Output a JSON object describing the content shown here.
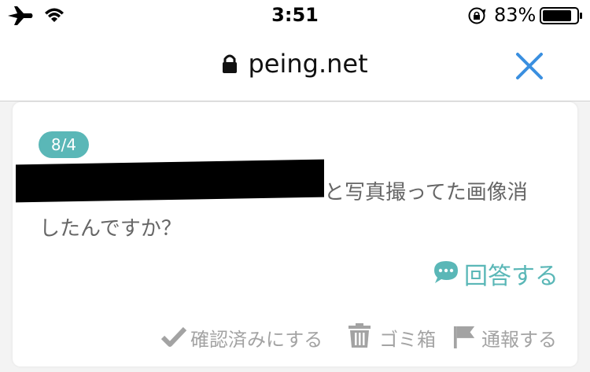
{
  "status_bar": {
    "time": "3:51",
    "battery_percent": "83%",
    "icons": [
      "airplane-icon",
      "wifi-icon",
      "orientation-lock-icon",
      "battery-icon"
    ]
  },
  "address_bar": {
    "url": "peing.net",
    "icons": [
      "lock-icon",
      "close-icon"
    ]
  },
  "card": {
    "date_badge": "8/4",
    "question_line1": "と写真撮ってた画像消",
    "question_line2": "したんですか？",
    "answer_label": "回答する",
    "actions": {
      "confirm": "確認済みにする",
      "trash": "ゴミ箱",
      "report": "通報する"
    }
  },
  "colors": {
    "accent": "#5ab7b7",
    "close_blue": "#3a8fe0",
    "muted_text": "#a3a3a3",
    "question_text": "#666666"
  }
}
